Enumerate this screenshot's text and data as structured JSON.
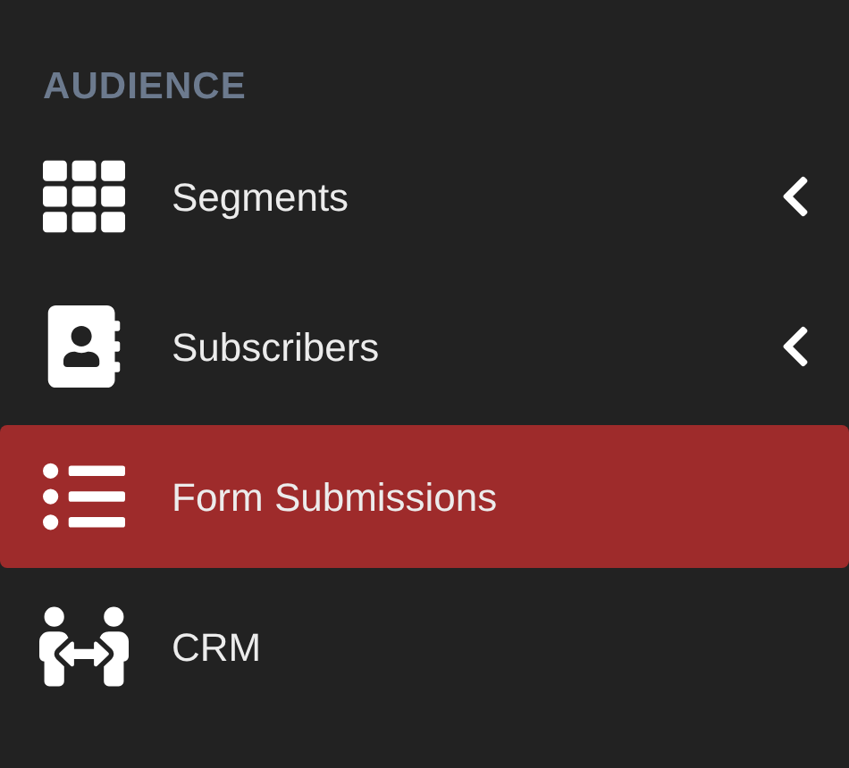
{
  "section": {
    "title": "AUDIENCE"
  },
  "items": [
    {
      "label": "Segments",
      "kind": "group",
      "expanded": false,
      "selected": false
    },
    {
      "label": "Subscribers",
      "kind": "group",
      "expanded": false,
      "selected": false
    },
    {
      "label": "Form Submissions",
      "kind": "link",
      "selected": true
    },
    {
      "label": "CRM",
      "kind": "link",
      "selected": false
    }
  ]
}
